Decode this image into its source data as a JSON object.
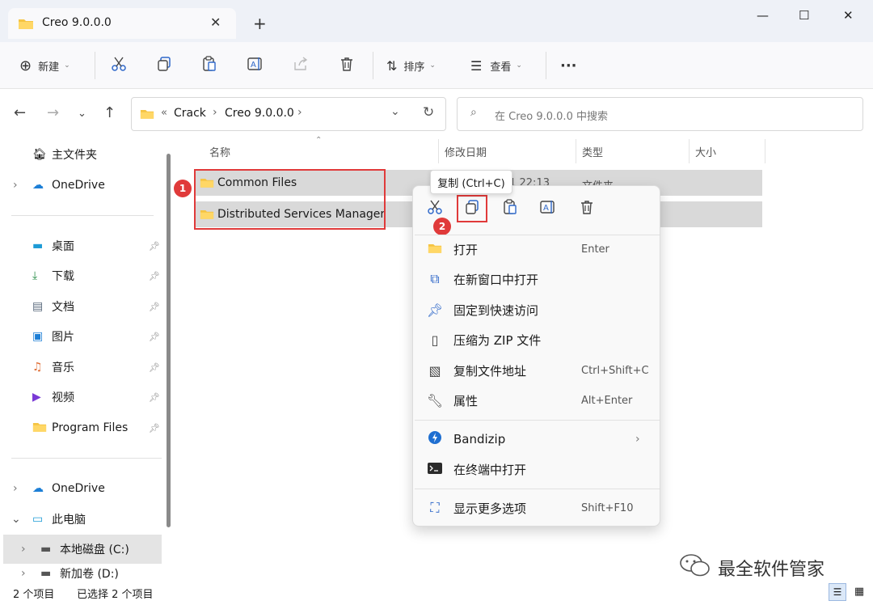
{
  "window": {
    "tab_title": "Creo 9.0.0.0",
    "new_tab": "+",
    "minimize": "—",
    "maximize": "☐",
    "close": "✕"
  },
  "toolbar": {
    "new_label": "新建",
    "sort_label": "排序",
    "view_label": "查看",
    "more": "···"
  },
  "address": {
    "prefix": "«",
    "crumbs": [
      "Crack",
      "Creo 9.0.0.0"
    ],
    "search_placeholder": "在 Creo 9.0.0.0 中搜索"
  },
  "sidebar": {
    "items": [
      {
        "label": "主文件夹",
        "icon": "home-icon"
      },
      {
        "label": "OneDrive",
        "icon": "cloud-icon"
      },
      {
        "label": "桌面",
        "icon": "desktop-icon"
      },
      {
        "label": "下载",
        "icon": "download-icon"
      },
      {
        "label": "文档",
        "icon": "document-icon"
      },
      {
        "label": "图片",
        "icon": "picture-icon"
      },
      {
        "label": "音乐",
        "icon": "music-icon"
      },
      {
        "label": "视频",
        "icon": "video-icon"
      },
      {
        "label": "Program Files",
        "icon": "folder-icon"
      },
      {
        "label": "OneDrive",
        "icon": "cloud-icon"
      },
      {
        "label": "此电脑",
        "icon": "computer-icon"
      },
      {
        "label": "本地磁盘 (C:)",
        "icon": "drive-icon"
      },
      {
        "label": "新加卷 (D:)",
        "icon": "drive-icon"
      }
    ]
  },
  "columns": {
    "name": "名称",
    "date": "修改日期",
    "type": "类型",
    "size": "大小"
  },
  "files": [
    {
      "name": "Common Files",
      "date": "2022/8/1 22:13",
      "type": "文件夹"
    },
    {
      "name": "Distributed Services Manager",
      "date": "",
      "type": ""
    }
  ],
  "annotations": {
    "badge1": "1",
    "badge2": "2"
  },
  "tooltip": "复制 (Ctrl+C)",
  "context_menu": {
    "items": [
      {
        "label": "打开",
        "shortcut": "Enter",
        "icon": "folder-open-icon"
      },
      {
        "label": "在新窗口中打开",
        "shortcut": "",
        "icon": "new-window-icon"
      },
      {
        "label": "固定到快速访问",
        "shortcut": "",
        "icon": "pin-icon"
      },
      {
        "label": "压缩为 ZIP 文件",
        "shortcut": "",
        "icon": "zip-icon"
      },
      {
        "label": "复制文件地址",
        "shortcut": "Ctrl+Shift+C",
        "icon": "copy-path-icon"
      },
      {
        "label": "属性",
        "shortcut": "Alt+Enter",
        "icon": "wrench-icon"
      },
      {
        "label": "Bandizip",
        "shortcut": "",
        "icon": "bandizip-icon"
      },
      {
        "label": "在终端中打开",
        "shortcut": "",
        "icon": "terminal-icon"
      },
      {
        "label": "显示更多选项",
        "shortcut": "Shift+F10",
        "icon": "more-options-icon"
      }
    ]
  },
  "status": {
    "count": "2 个项目",
    "selected": "已选择 2 个项目"
  },
  "watermark": "最全软件管家"
}
